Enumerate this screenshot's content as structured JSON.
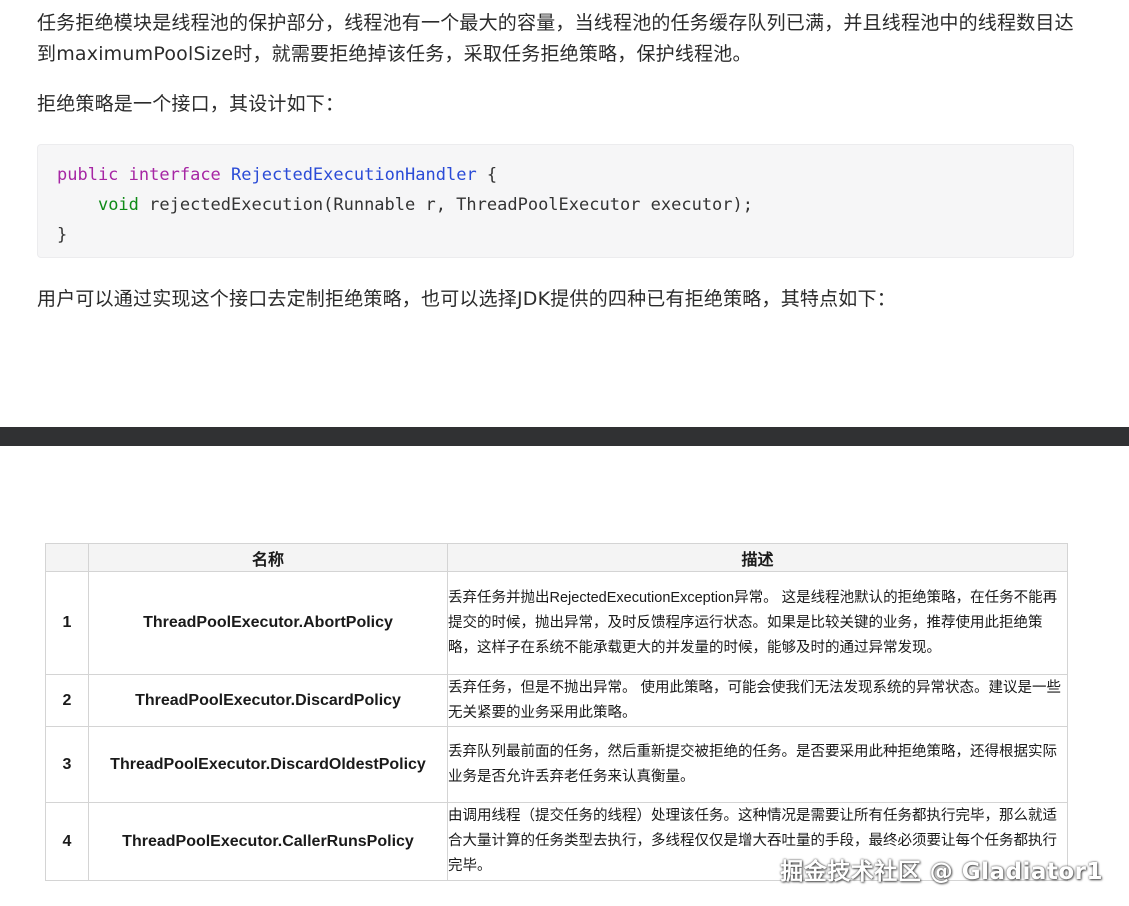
{
  "article": {
    "intro": "任务拒绝模块是线程池的保护部分，线程池有一个最大的容量，当线程池的任务缓存队列已满，并且线程池中的线程数目达到maximumPoolSize时，就需要拒绝掉该任务，采取任务拒绝策略，保护线程池。",
    "interface_intro": "拒绝策略是一个接口，其设计如下：",
    "followup": "用户可以通过实现这个接口去定制拒绝策略，也可以选择JDK提供的四种已有拒绝策略，其特点如下："
  },
  "code": {
    "line1_kw1": "public",
    "line1_kw2": "interface",
    "line1_name": "RejectedExecutionHandler",
    "line1_rest": " {",
    "line2_indent": "    ",
    "line2_kw": "void",
    "line2_rest": " rejectedExecution(Runnable r, ThreadPoolExecutor executor);",
    "line3": "}"
  },
  "table": {
    "headers": [
      "",
      "名称",
      "描述"
    ],
    "rows": [
      {
        "num": "1",
        "name": "ThreadPoolExecutor.AbortPolicy",
        "desc": "丢弃任务并抛出RejectedExecutionException异常。 这是线程池默认的拒绝策略，在任务不能再提交的时候，抛出异常，及时反馈程序运行状态。如果是比较关键的业务，推荐使用此拒绝策略，这样子在系统不能承载更大的并发量的时候，能够及时的通过异常发现。"
      },
      {
        "num": "2",
        "name": "ThreadPoolExecutor.DiscardPolicy",
        "desc": "丢弃任务，但是不抛出异常。 使用此策略，可能会使我们无法发现系统的异常状态。建议是一些无关紧要的业务采用此策略。"
      },
      {
        "num": "3",
        "name": "ThreadPoolExecutor.DiscardOldestPolicy",
        "desc": "丢弃队列最前面的任务，然后重新提交被拒绝的任务。是否要采用此种拒绝策略，还得根据实际业务是否允许丢弃老任务来认真衡量。"
      },
      {
        "num": "4",
        "name": "ThreadPoolExecutor.CallerRunsPolicy",
        "desc": "由调用线程（提交任务的线程）处理该任务。这种情况是需要让所有任务都执行完毕，那么就适合大量计算的任务类型去执行，多线程仅仅是增大吞吐量的手段，最终必须要让每个任务都执行完毕。"
      }
    ]
  },
  "watermark": "掘金技术社区 @ Gladiator1",
  "colors": {
    "code_bg": "#f6f6f7",
    "keyword_purple": "#a626a4",
    "keyword_green": "#0e8a16",
    "type_blue": "#2a4bd7",
    "divider": "#303133",
    "table_header_bg": "#f4f4f4"
  }
}
